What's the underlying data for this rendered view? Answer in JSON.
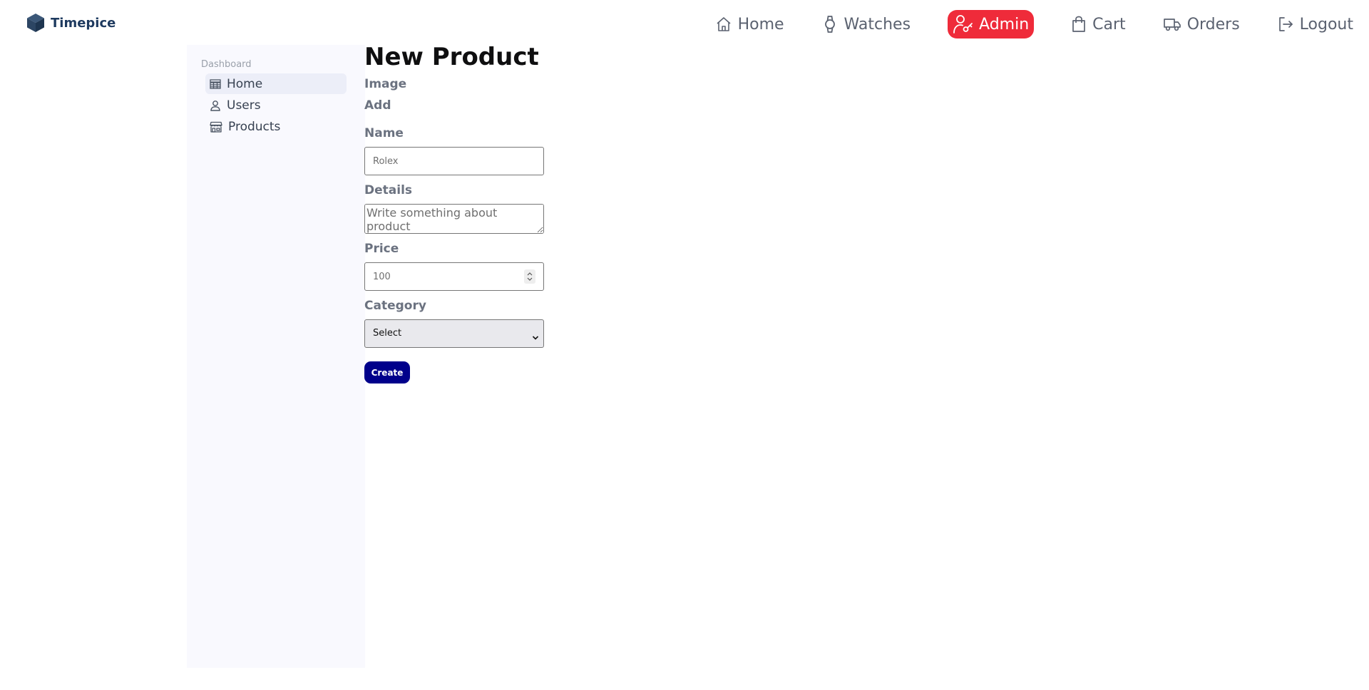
{
  "brand": {
    "name": "Timepice",
    "icon": "cube-icon"
  },
  "nav": {
    "items": [
      {
        "label": "Home",
        "icon": "home-icon",
        "active": false
      },
      {
        "label": "Watches",
        "icon": "watch-icon",
        "active": false
      },
      {
        "label": "Admin",
        "icon": "admin-key-icon",
        "active": true
      },
      {
        "label": "Cart",
        "icon": "shopping-bag-icon",
        "active": false
      },
      {
        "label": "Orders",
        "icon": "truck-icon",
        "active": false
      },
      {
        "label": "Logout",
        "icon": "logout-icon",
        "active": false
      }
    ],
    "active_color": "#ef2b3a"
  },
  "sidebar": {
    "heading": "Dashboard",
    "items": [
      {
        "label": "Home",
        "icon": "table-icon",
        "selected": true
      },
      {
        "label": "Users",
        "icon": "user-icon",
        "selected": false
      },
      {
        "label": "Products",
        "icon": "store-icon",
        "selected": false
      }
    ]
  },
  "form": {
    "title": "New Product",
    "image_label": "Image",
    "image_add_label": "Add",
    "name_label": "Name",
    "name_placeholder": "Rolex",
    "details_label": "Details",
    "details_placeholder": "Write something about product",
    "price_label": "Price",
    "price_placeholder": "100",
    "category_label": "Category",
    "category_selected": "Select",
    "create_label": "Create",
    "create_color": "#00008b"
  }
}
